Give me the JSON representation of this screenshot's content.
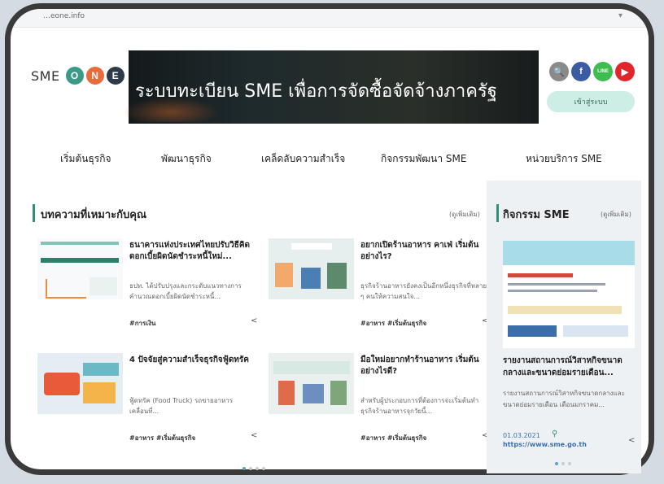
{
  "browser": {
    "url": "…eone.info"
  },
  "header": {
    "logo": {
      "sme": "SME",
      "o": "O",
      "n": "N",
      "e": "E"
    },
    "banner_text": "ระบบทะเบียน SME เพื่อการจัดซื้อจัดจ้างภาครัฐ",
    "social": {
      "search": "🔍",
      "facebook": "f",
      "line": "LINE",
      "youtube": "▶"
    },
    "login_label": "เข้าสู่ระบบ"
  },
  "nav": [
    "เริ่มต้นธุรกิจ",
    "พัฒนาธุรกิจ",
    "เคล็ดลับความสำเร็จ",
    "กิจกรรมพัฒนา SME",
    "หน่วยบริการ SME"
  ],
  "articles": {
    "title": "บทความที่เหมาะกับคุณ",
    "see_all": "(ดูเพิ่มเติม)",
    "items": [
      {
        "title": "ธนาคารแห่งประเทศไทยปรับวิธีคิดดอกเบี้ยผิดนัดชำระหนี้ใหม่...",
        "desc": "ธปท. ได้ปรับปรุงและกระดับแนวทางการคำนวณดอกเบี้ยผิดนัดชำระหนี้...",
        "tags": "#การเงิน"
      },
      {
        "title": "อยากเปิดร้านอาหาร คาเฟ่ เริ่มต้นอย่างไร?",
        "desc": "ธุรกิจร้านอาหารยังคงเป็นอีกหนึ่งธุรกิจที่หลาย ๆ คนให้ความสนใจ...",
        "tags": "#อาหาร #เริ่มต้นธุรกิจ"
      },
      {
        "title": "4 ปัจจัยสู่ความสำเร็จธุรกิจฟู้ดทรัค",
        "desc": "ฟู้ดทรัค (Food Truck) รถขายอาหารเคลื่อนที่...",
        "tags": "#อาหาร #เริ่มต้นธุรกิจ"
      },
      {
        "title": "มือใหม่อยากทำร้านอาหาร เริ่มต้นอย่างไรดี?",
        "desc": "สำหรับผู้ประกอบการที่ต้องการจะเริ่มต้นทำธุรกิจร้านอาหารจุกวัยนี้...",
        "tags": "#อาหาร #เริ่มต้นธุรกิจ"
      }
    ],
    "share_icon": "<"
  },
  "activities": {
    "title": "กิจกรรม SME",
    "see_all": "(ดูเพิ่มเติม)",
    "item": {
      "title": "รายงานสถานการณ์วิสาหกิจขนาดกลางและขนาดย่อมรายเดือน...",
      "desc": "รายงานสถานการณ์วิสาหกิจขนาดกลางและขนาดย่อมรายเดือน เดือนมกราคม...",
      "date": "01.03.2021",
      "url": "https://www.sme.go.th"
    }
  }
}
